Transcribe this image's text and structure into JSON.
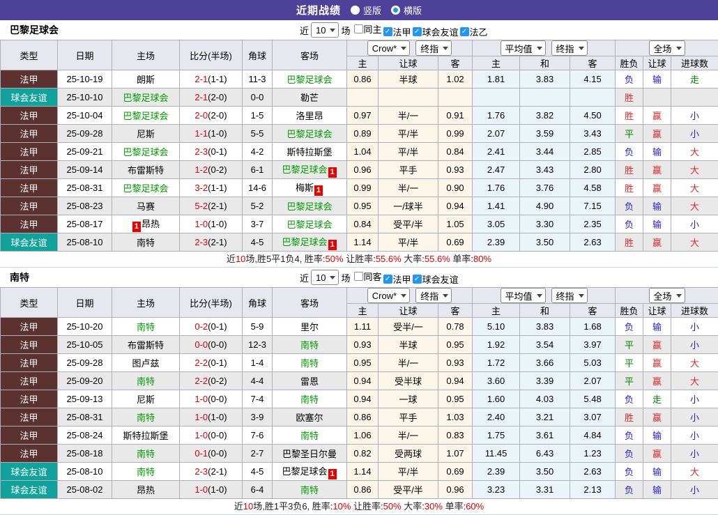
{
  "top_bar": {
    "title": "近期战绩",
    "radio_vertical": "竖版",
    "radio_horizontal": "横版",
    "selected": "横版"
  },
  "colors": {
    "topbar": "#4e4199",
    "ligue": "#5c3231",
    "friendly": "#11a39b",
    "score_red": "#e10000",
    "team_green": "#009900",
    "win_red": "#d62b2b",
    "lose_blue": "#2323cc",
    "draw_green": "#008800",
    "odds_bg": "#fcf5ea",
    "avg_bg": "#ebf4f8"
  },
  "table_header": {
    "col_type": "类型",
    "col_date": "日期",
    "col_home": "主场",
    "col_score": "比分(半场)",
    "col_corner": "角球",
    "col_away": "客场",
    "select_crow": "Crow*",
    "select_final1": "终指",
    "select_avg": "平均值",
    "select_final2": "终指",
    "select_scope": "全场",
    "sub_home": "主",
    "sub_handicap": "让球",
    "sub_away": "客",
    "sub_avg_home": "主",
    "sub_avg_draw": "和",
    "sub_avg_away": "客",
    "col_result": "胜负",
    "col_handicap_result": "让球",
    "col_goals": "进球数"
  },
  "sections": [
    {
      "team": "巴黎足球会",
      "controls": {
        "near": "近",
        "count": "10",
        "suffix": "场",
        "filters": [
          {
            "label": "同主",
            "checked": false
          },
          {
            "label": "法甲",
            "checked": true
          },
          {
            "label": "球会友谊",
            "checked": true
          },
          {
            "label": "法乙",
            "checked": true
          }
        ]
      },
      "rows": [
        {
          "type": "法甲",
          "tc": "ligue",
          "date": "25-10-19",
          "home": {
            "n": "朗斯"
          },
          "score": "2-1",
          "half": "(1-1)",
          "corner": "11-3",
          "away": {
            "n": "巴黎足球会",
            "g": 1
          },
          "odds": [
            "0.86",
            "半球",
            "1.02"
          ],
          "avg": [
            "1.81",
            "3.83",
            "4.15"
          ],
          "res": [
            [
              "负",
              "b"
            ],
            [
              "输",
              "b"
            ],
            [
              "走",
              "g"
            ]
          ]
        },
        {
          "type": "球会友谊",
          "tc": "friendly",
          "date": "25-10-10",
          "home": {
            "n": "巴黎足球会",
            "g": 1
          },
          "score": "2-1",
          "half": "(2-0)",
          "corner": "0-0",
          "away": {
            "n": "勒芒"
          },
          "odds": [
            "",
            "",
            ""
          ],
          "avg": [
            "",
            "",
            ""
          ],
          "res": [
            [
              "胜",
              "r"
            ],
            [
              "",
              ""
            ],
            [
              "",
              ""
            ]
          ]
        },
        {
          "type": "法甲",
          "tc": "ligue",
          "date": "25-10-04",
          "home": {
            "n": "巴黎足球会",
            "g": 1
          },
          "score": "2-0",
          "half": "(2-0)",
          "corner": "1-5",
          "away": {
            "n": "洛里昂"
          },
          "odds": [
            "0.97",
            "半/一",
            "0.91"
          ],
          "avg": [
            "1.76",
            "3.82",
            "4.50"
          ],
          "res": [
            [
              "胜",
              "r"
            ],
            [
              "赢",
              "r"
            ],
            [
              "小",
              "b"
            ]
          ]
        },
        {
          "type": "法甲",
          "tc": "ligue",
          "date": "25-09-28",
          "home": {
            "n": "尼斯"
          },
          "score": "1-1",
          "half": "(1-0)",
          "corner": "5-5",
          "away": {
            "n": "巴黎足球会",
            "g": 1
          },
          "odds": [
            "0.89",
            "平/半",
            "0.99"
          ],
          "avg": [
            "2.07",
            "3.59",
            "3.43"
          ],
          "res": [
            [
              "平",
              "g"
            ],
            [
              "赢",
              "r"
            ],
            [
              "小",
              "b"
            ]
          ]
        },
        {
          "type": "法甲",
          "tc": "ligue",
          "date": "25-09-21",
          "home": {
            "n": "巴黎足球会",
            "g": 1
          },
          "score": "2-3",
          "half": "(0-1)",
          "corner": "4-2",
          "away": {
            "n": "斯特拉斯堡"
          },
          "odds": [
            "1.04",
            "平/半",
            "0.84"
          ],
          "avg": [
            "2.41",
            "3.44",
            "2.85"
          ],
          "res": [
            [
              "负",
              "b"
            ],
            [
              "输",
              "b"
            ],
            [
              "大",
              "r"
            ]
          ]
        },
        {
          "type": "法甲",
          "tc": "ligue",
          "date": "25-09-14",
          "home": {
            "n": "布雷斯特"
          },
          "score": "1-2",
          "half": "(0-2)",
          "corner": "6-1",
          "away": {
            "n": "巴黎足球会",
            "g": 1,
            "b": "R"
          },
          "odds": [
            "0.96",
            "平手",
            "0.93"
          ],
          "avg": [
            "2.47",
            "3.43",
            "2.80"
          ],
          "res": [
            [
              "胜",
              "r"
            ],
            [
              "赢",
              "r"
            ],
            [
              "大",
              "r"
            ]
          ]
        },
        {
          "type": "法甲",
          "tc": "ligue",
          "date": "25-08-31",
          "home": {
            "n": "巴黎足球会",
            "g": 1
          },
          "score": "3-2",
          "half": "(1-1)",
          "corner": "14-6",
          "away": {
            "n": "梅斯",
            "b": "R"
          },
          "odds": [
            "0.99",
            "半/一",
            "0.90"
          ],
          "avg": [
            "1.76",
            "3.76",
            "4.58"
          ],
          "res": [
            [
              "胜",
              "r"
            ],
            [
              "赢",
              "r"
            ],
            [
              "大",
              "r"
            ]
          ]
        },
        {
          "type": "法甲",
          "tc": "ligue",
          "date": "25-08-23",
          "home": {
            "n": "马赛"
          },
          "score": "5-2",
          "half": "(2-1)",
          "corner": "5-2",
          "away": {
            "n": "巴黎足球会",
            "g": 1
          },
          "odds": [
            "0.95",
            "一/球半",
            "0.94"
          ],
          "avg": [
            "1.41",
            "4.90",
            "7.15"
          ],
          "res": [
            [
              "负",
              "b"
            ],
            [
              "输",
              "b"
            ],
            [
              "大",
              "r"
            ]
          ]
        },
        {
          "type": "法甲",
          "tc": "ligue",
          "date": "25-08-17",
          "home": {
            "n": "昂热",
            "b": "L"
          },
          "score": "1-0",
          "half": "(1-0)",
          "corner": "3-7",
          "away": {
            "n": "巴黎足球会",
            "g": 1
          },
          "odds": [
            "0.84",
            "受平/半",
            "1.05"
          ],
          "avg": [
            "3.05",
            "3.30",
            "2.35"
          ],
          "res": [
            [
              "负",
              "b"
            ],
            [
              "输",
              "b"
            ],
            [
              "小",
              "b"
            ]
          ]
        },
        {
          "type": "球会友谊",
          "tc": "friendly",
          "date": "25-08-10",
          "home": {
            "n": "南特"
          },
          "score": "2-3",
          "half": "(2-1)",
          "corner": "4-5",
          "away": {
            "n": "巴黎足球会",
            "g": 1,
            "b": "R"
          },
          "odds": [
            "1.14",
            "平/半",
            "0.69"
          ],
          "avg": [
            "2.39",
            "3.50",
            "2.63"
          ],
          "res": [
            [
              "胜",
              "r"
            ],
            [
              "赢",
              "r"
            ],
            [
              "大",
              "r"
            ]
          ]
        }
      ],
      "summary": {
        "parts": [
          [
            "近",
            "k"
          ],
          [
            "10",
            "r"
          ],
          [
            "场,胜5平1负4, 胜率:",
            "k"
          ],
          [
            "50%",
            "r"
          ],
          [
            " 让胜率:",
            "k"
          ],
          [
            "55.6%",
            "r"
          ],
          [
            " 大率:",
            "k"
          ],
          [
            "55.6%",
            "r"
          ],
          [
            " 单率:",
            "k"
          ],
          [
            "80%",
            "r"
          ]
        ]
      }
    },
    {
      "team": "南特",
      "controls": {
        "near": "近",
        "count": "10",
        "suffix": "场",
        "filters": [
          {
            "label": "同客",
            "checked": false
          },
          {
            "label": "法甲",
            "checked": true
          },
          {
            "label": "球会友谊",
            "checked": true
          }
        ]
      },
      "rows": [
        {
          "type": "法甲",
          "tc": "ligue",
          "date": "25-10-20",
          "home": {
            "n": "南特",
            "g": 1
          },
          "score": "0-2",
          "half": "(0-1)",
          "corner": "5-9",
          "away": {
            "n": "里尔"
          },
          "odds": [
            "1.11",
            "受半/一",
            "0.78"
          ],
          "avg": [
            "5.10",
            "3.83",
            "1.68"
          ],
          "res": [
            [
              "负",
              "b"
            ],
            [
              "输",
              "b"
            ],
            [
              "小",
              "b"
            ]
          ]
        },
        {
          "type": "法甲",
          "tc": "ligue",
          "date": "25-10-05",
          "home": {
            "n": "布雷斯特"
          },
          "score": "0-0",
          "half": "(0-0)",
          "corner": "12-3",
          "away": {
            "n": "南特",
            "g": 1
          },
          "odds": [
            "0.93",
            "半球",
            "0.95"
          ],
          "avg": [
            "1.92",
            "3.54",
            "3.97"
          ],
          "res": [
            [
              "平",
              "g"
            ],
            [
              "赢",
              "r"
            ],
            [
              "小",
              "b"
            ]
          ]
        },
        {
          "type": "法甲",
          "tc": "ligue",
          "date": "25-09-28",
          "home": {
            "n": "图卢兹"
          },
          "score": "2-2",
          "half": "(0-1)",
          "corner": "1-4",
          "away": {
            "n": "南特",
            "g": 1
          },
          "odds": [
            "0.95",
            "半/一",
            "0.93"
          ],
          "avg": [
            "1.72",
            "3.66",
            "5.03"
          ],
          "res": [
            [
              "平",
              "g"
            ],
            [
              "赢",
              "r"
            ],
            [
              "大",
              "r"
            ]
          ]
        },
        {
          "type": "法甲",
          "tc": "ligue",
          "date": "25-09-20",
          "home": {
            "n": "南特",
            "g": 1
          },
          "score": "2-2",
          "half": "(0-2)",
          "corner": "4-4",
          "away": {
            "n": "雷恩"
          },
          "odds": [
            "0.94",
            "受半球",
            "0.94"
          ],
          "avg": [
            "3.60",
            "3.39",
            "2.07"
          ],
          "res": [
            [
              "平",
              "g"
            ],
            [
              "赢",
              "r"
            ],
            [
              "大",
              "r"
            ]
          ]
        },
        {
          "type": "法甲",
          "tc": "ligue",
          "date": "25-09-13",
          "home": {
            "n": "尼斯"
          },
          "score": "1-0",
          "half": "(0-0)",
          "corner": "7-4",
          "away": {
            "n": "南特",
            "g": 1
          },
          "odds": [
            "0.94",
            "一球",
            "0.95"
          ],
          "avg": [
            "1.60",
            "4.03",
            "5.48"
          ],
          "res": [
            [
              "负",
              "b"
            ],
            [
              "走",
              "g"
            ],
            [
              "小",
              "b"
            ]
          ]
        },
        {
          "type": "法甲",
          "tc": "ligue",
          "date": "25-08-31",
          "home": {
            "n": "南特",
            "g": 1
          },
          "score": "1-0",
          "half": "(1-0)",
          "corner": "3-9",
          "away": {
            "n": "欧塞尔"
          },
          "odds": [
            "0.86",
            "平手",
            "1.03"
          ],
          "avg": [
            "2.40",
            "3.21",
            "3.07"
          ],
          "res": [
            [
              "胜",
              "r"
            ],
            [
              "赢",
              "r"
            ],
            [
              "小",
              "b"
            ]
          ]
        },
        {
          "type": "法甲",
          "tc": "ligue",
          "date": "25-08-24",
          "home": {
            "n": "斯特拉斯堡"
          },
          "score": "1-0",
          "half": "(0-0)",
          "corner": "7-6",
          "away": {
            "n": "南特",
            "g": 1
          },
          "odds": [
            "1.06",
            "半/一",
            "0.83"
          ],
          "avg": [
            "1.75",
            "3.61",
            "4.84"
          ],
          "res": [
            [
              "负",
              "b"
            ],
            [
              "输",
              "b"
            ],
            [
              "小",
              "b"
            ]
          ]
        },
        {
          "type": "法甲",
          "tc": "ligue",
          "date": "25-08-18",
          "home": {
            "n": "南特",
            "g": 1
          },
          "score": "0-1",
          "half": "(0-0)",
          "corner": "2-7",
          "away": {
            "n": "巴黎圣日尔曼"
          },
          "odds": [
            "0.82",
            "受两球",
            "1.07"
          ],
          "avg": [
            "11.45",
            "6.43",
            "1.23"
          ],
          "res": [
            [
              "负",
              "b"
            ],
            [
              "赢",
              "r"
            ],
            [
              "小",
              "b"
            ]
          ]
        },
        {
          "type": "球会友谊",
          "tc": "friendly",
          "date": "25-08-10",
          "home": {
            "n": "南特",
            "g": 1
          },
          "score": "2-3",
          "half": "(2-1)",
          "corner": "4-5",
          "away": {
            "n": "巴黎足球会",
            "b": "R"
          },
          "odds": [
            "1.14",
            "平/半",
            "0.69"
          ],
          "avg": [
            "2.39",
            "3.50",
            "2.63"
          ],
          "res": [
            [
              "负",
              "b"
            ],
            [
              "输",
              "b"
            ],
            [
              "大",
              "r"
            ]
          ]
        },
        {
          "type": "球会友谊",
          "tc": "friendly",
          "date": "25-08-02",
          "home": {
            "n": "昂热"
          },
          "score": "1-0",
          "half": "(1-0)",
          "corner": "6-4",
          "away": {
            "n": "南特",
            "g": 1
          },
          "odds": [
            "0.86",
            "受平/半",
            "0.96"
          ],
          "avg": [
            "3.23",
            "3.31",
            "2.13"
          ],
          "res": [
            [
              "负",
              "b"
            ],
            [
              "输",
              "b"
            ],
            [
              "小",
              "b"
            ]
          ]
        }
      ],
      "summary": {
        "parts": [
          [
            "近",
            "k"
          ],
          [
            "10",
            "r"
          ],
          [
            "场,胜1平3负6, 胜率:",
            "k"
          ],
          [
            "10%",
            "r"
          ],
          [
            " 让胜率:",
            "k"
          ],
          [
            "50%",
            "r"
          ],
          [
            " 大率:",
            "k"
          ],
          [
            "30%",
            "r"
          ],
          [
            " 单率:",
            "k"
          ],
          [
            "60%",
            "r"
          ]
        ]
      }
    }
  ]
}
